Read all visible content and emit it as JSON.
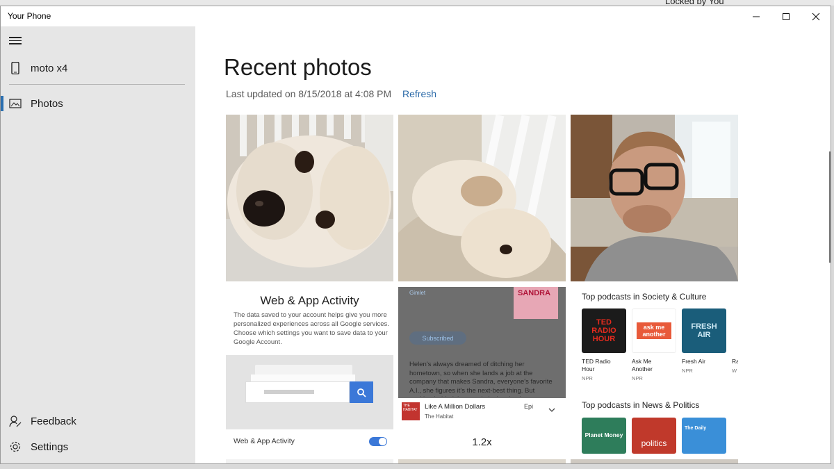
{
  "background": {
    "window_title_fragment": "Locked by You"
  },
  "window": {
    "title": "Your Phone"
  },
  "sidebar": {
    "device": {
      "name": "moto x4",
      "icon": "phone-icon"
    },
    "items": [
      {
        "label": "Photos",
        "icon": "photos-icon",
        "selected": true
      }
    ],
    "bottom_items": [
      {
        "label": "Feedback",
        "icon": "feedback-icon"
      },
      {
        "label": "Settings",
        "icon": "gear-icon"
      }
    ]
  },
  "main": {
    "title": "Recent photos",
    "last_updated": "Last updated on 8/15/2018 at 4:08 PM",
    "refresh_label": "Refresh",
    "photos": [
      {
        "kind": "screenshot-activity",
        "heading": "Web & App Activity",
        "body": "The data saved to your account helps give you more personalized experiences across all Google services. Choose which settings you want to save data to your Google Account.",
        "toggle_label": "Web & App Activity",
        "toggle_on": true
      },
      {
        "kind": "screenshot-podcast",
        "publisher": "Gimlet",
        "cover_text": "SANDRA",
        "subscribed_label": "Subscribed",
        "description": "Helen's always dreamed of ditching her hometown, so when she lands a job at the company that makes Sandra, everyone's favorite A.I., she figures it's the next-best thing. But working behind the curtain isn't quite the escape ...",
        "now_playing_title": "Like A Million Dollars",
        "now_playing_show": "The Habitat",
        "now_playing_art": "THE HABITAT",
        "episode_label": "Epi",
        "speed": "1.2x"
      },
      {
        "kind": "screenshot-podcast-list",
        "section1": "Top podcasts in Society & Culture",
        "section1_items": [
          {
            "title": "TED Radio Hour",
            "line1": "TED Radio",
            "line2": "Hour",
            "publisher": "NPR",
            "art_text": "TED RADIO HOUR",
            "color": "#1b1b1b"
          },
          {
            "title": "Ask Me Another",
            "line1": "Ask Me",
            "line2": "Another",
            "publisher": "NPR",
            "art_text": "ask me another",
            "color": "#ffffff"
          },
          {
            "title": "Fresh Air",
            "line1": "Fresh Air",
            "line2": "",
            "publisher": "NPR",
            "art_text": "FRESH AIR",
            "color": "#1a5d7a"
          },
          {
            "title": "Ra",
            "line1": "Ra",
            "line2": "",
            "publisher": "W",
            "art_text": "",
            "color": "#ffffff"
          }
        ],
        "section2": "Top podcasts in News & Politics",
        "section2_items": [
          {
            "title": "Planet Money",
            "art_text": "Planet Money",
            "color": "#2e7d5b"
          },
          {
            "title": "NPR Politics",
            "art_text": "politics",
            "color": "#c0392b"
          },
          {
            "title": "The Daily",
            "art_text": "The Daily",
            "color": "#3a8fd8"
          }
        ]
      }
    ]
  },
  "colors": {
    "accent": "#2a6fb0",
    "link": "#2b6aa8",
    "sidebar_bg": "#e6e6e6"
  }
}
